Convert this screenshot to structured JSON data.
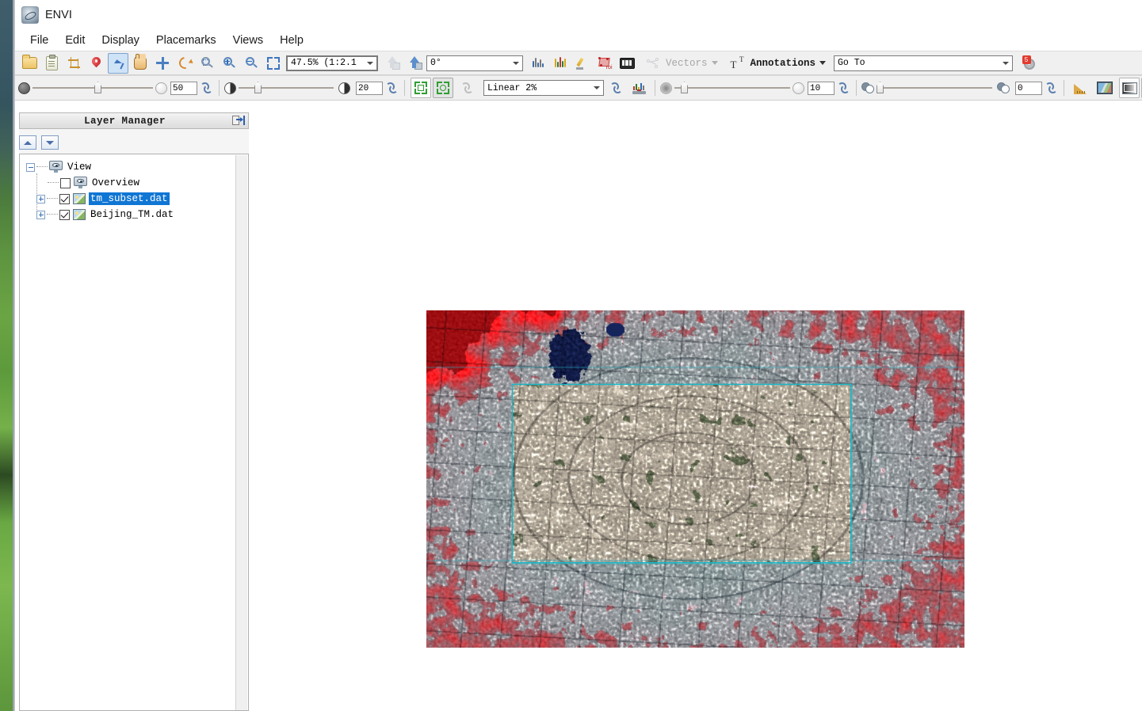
{
  "window": {
    "title": "ENVI",
    "app_icon": "envi-globe-icon"
  },
  "menu": {
    "items": [
      {
        "label": "File"
      },
      {
        "label": "Edit"
      },
      {
        "label": "Display"
      },
      {
        "label": "Placemarks"
      },
      {
        "label": "Views"
      },
      {
        "label": "Help"
      }
    ]
  },
  "toolbar_main": {
    "open_file": "open-file-icon",
    "paste_clipboard": "clipboard-icon",
    "crop": "crop-icon",
    "placemark": "placemark-pin-icon",
    "select_tool": "select-arrow-icon",
    "pan_tool": "pan-hand-icon",
    "move_tool": "move-crosshair-icon",
    "rotate_tool": "rotate-icon",
    "zoom_to_extent": "zoom-fit-icon",
    "zoom_in": "zoom-in-icon",
    "zoom_out": "zoom-out-icon",
    "zoom_select": "zoom-selection-icon",
    "zoom_value": "47.5% (1:2.1",
    "fly_up_disabled": "fly-up-disabled-icon",
    "fly_to": "fly-to-icon",
    "rotation_value": "0°",
    "spectral_profile": "spectral-profile-icon",
    "multi_spectral_profile": "multi-spectral-profile-icon",
    "pixel_locator": "pen-measure-icon",
    "roi_tool": "roi-icon",
    "counter_tool": "counter-008-icon",
    "vectors_label": "Vectors",
    "vectors_icon": "vector-node-icon",
    "annotations_label": "Annotations",
    "annotations_icon": "annotation-text-icon",
    "goto_value": "Go To",
    "extensions_icon": "extensions-gear-icon",
    "extensions_badge": "5"
  },
  "toolbar_display": {
    "transparency_value": "50",
    "transparency_refresh": "reset-transparency-icon",
    "brightness_value": "20",
    "brightness_refresh": "reset-brightness-icon",
    "stretch_square_icon": "stretch-square-icon",
    "stretch_circle_icon": "stretch-circle-icon",
    "stretch_reset_icon": "stretch-reset-disabled-icon",
    "stretch_type": "Linear 2%",
    "stretch_refresh": "reset-stretch-icon",
    "histogram_icon": "histogram-icon",
    "sharpen_value": "10",
    "sharpen_refresh": "reset-sharpen-icon",
    "blend_value": "0",
    "blend_refresh": "reset-blend-icon",
    "measure_icon": "ruler-measure-icon",
    "image_icon": "image-thumbnail-icon",
    "gradient_icon": "gradient-panel-icon",
    "window_icon": "window-stack-icon"
  },
  "layer_manager": {
    "title": "Layer Manager",
    "dock_icon": "dock-panel-icon",
    "move_up_icon": "chevron-up-icon",
    "move_down_icon": "chevron-down-icon",
    "tree": {
      "root": {
        "label": "View",
        "icon": "view-display-icon",
        "expanded": true
      },
      "children": [
        {
          "label": "Overview",
          "icon": "view-display-icon",
          "checked": false,
          "expandable": false,
          "selected": false
        },
        {
          "label": "tm_subset.dat",
          "icon": "raster-layer-icon",
          "checked": true,
          "expandable": true,
          "selected": true
        },
        {
          "label": "Beijing_TM.dat",
          "icon": "raster-layer-icon",
          "checked": true,
          "expandable": true,
          "selected": false
        }
      ]
    }
  },
  "image_view": {
    "description": "Landsat TM false-color composite of Beijing displayed in the view",
    "subset_overlay_color": "#18b6c8",
    "base_layer": "Beijing_TM.dat",
    "subset_layer": "tm_subset.dat"
  },
  "colors": {
    "accent_blue": "#1076d4",
    "toolbar_bg": "#f0f0f0",
    "panel_bg": "#f5f5f5",
    "subset_cyan": "#18b6c8",
    "vegetation_red": "#d8202a",
    "urban_cyan": "#a9c9cf"
  }
}
